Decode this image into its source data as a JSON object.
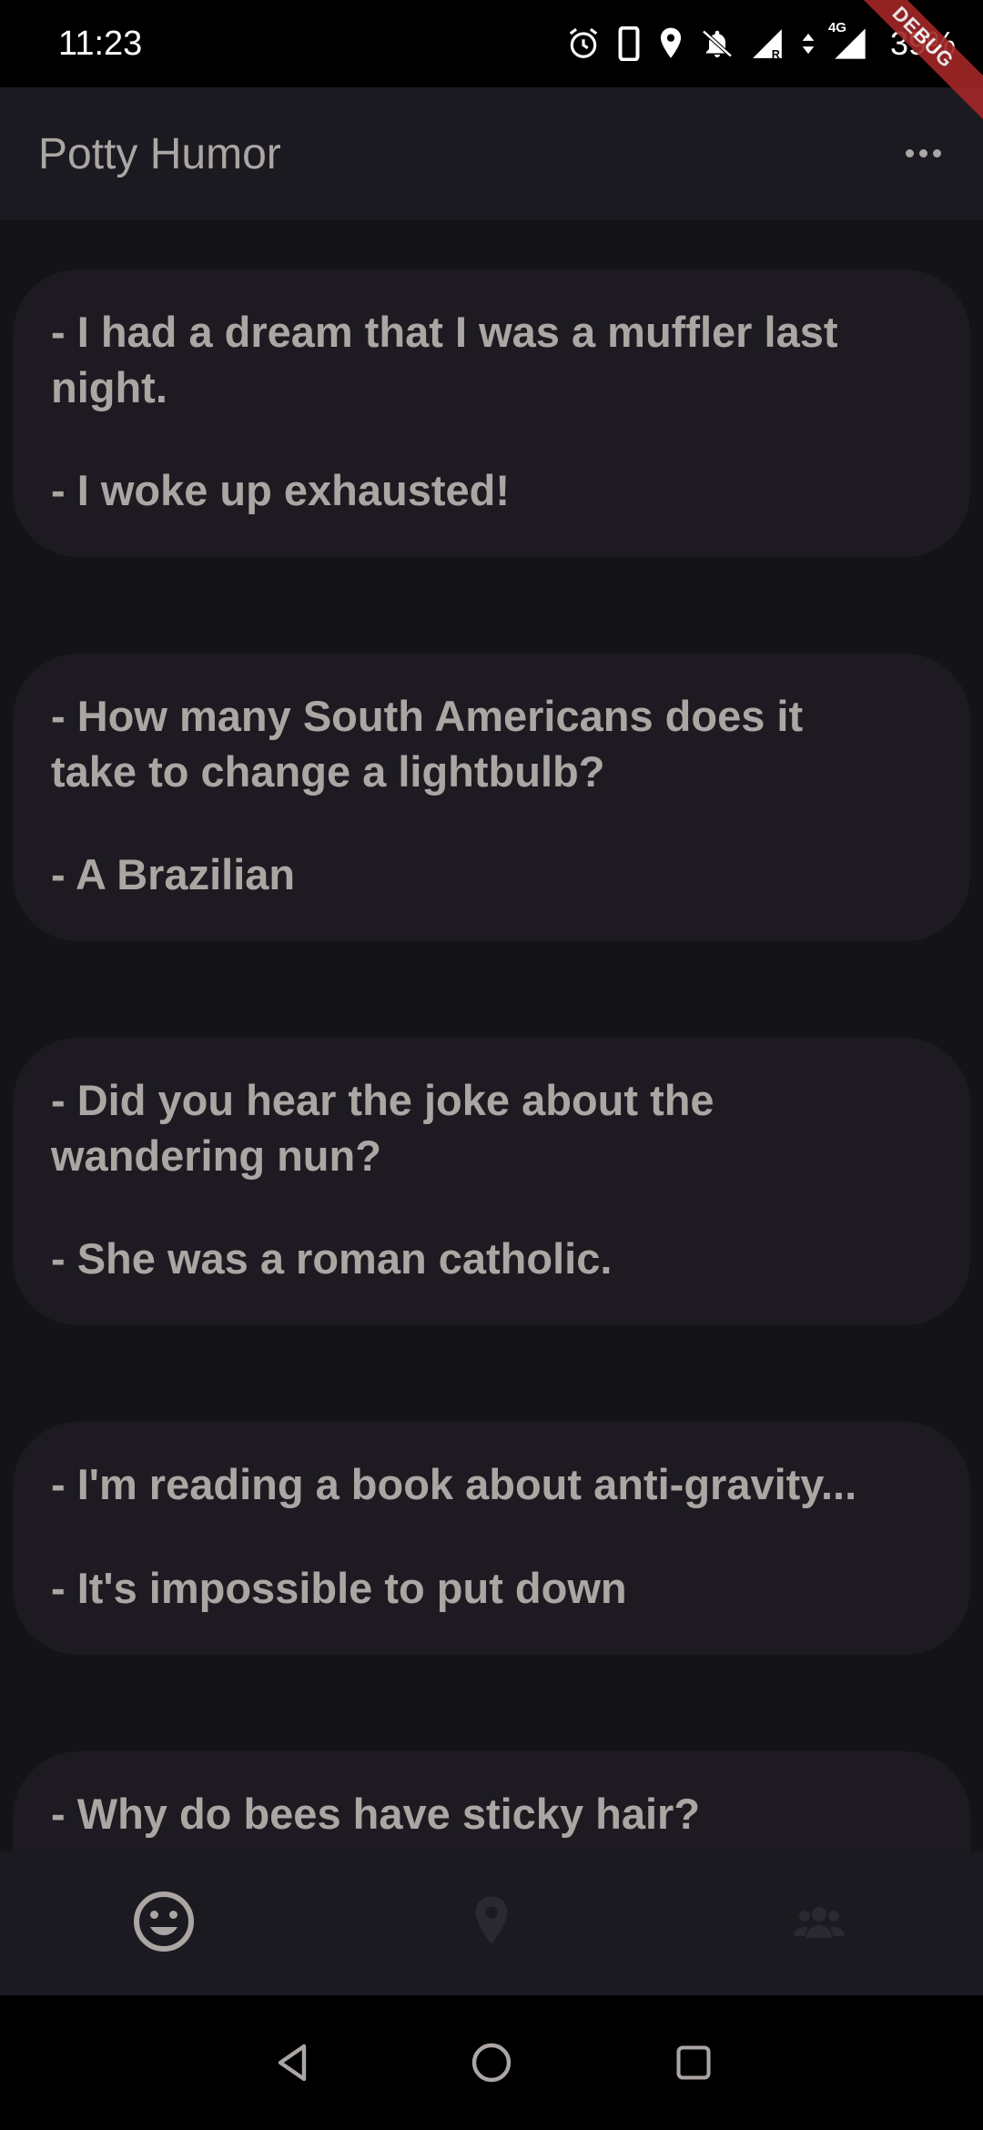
{
  "status_bar": {
    "time": "11:23",
    "battery_percent": "39%",
    "network_label": "4G",
    "icons": [
      "alarm-icon",
      "phone-icon",
      "location-icon",
      "notifications-off-icon",
      "signal-roaming-icon",
      "data-arrows-icon",
      "signal-icon"
    ]
  },
  "debug_banner": "DEBUG",
  "app_bar": {
    "title": "Potty Humor",
    "menu_icon": "more-horiz-icon"
  },
  "jokes": [
    {
      "setup_line1": "- I had a dream that I was a muffler last",
      "setup_line2": "night.",
      "punchline": "- I woke up exhausted!"
    },
    {
      "setup_line1": "- How many South Americans does it",
      "setup_line2": "take to change a lightbulb?",
      "punchline": "- A Brazilian"
    },
    {
      "setup_line1": "- Did you hear the joke about the",
      "setup_line2": "wandering nun?",
      "punchline": "- She was a roman catholic."
    },
    {
      "setup_line1": "- I'm reading a book about anti-gravity...",
      "punchline": "- It's impossible to put down"
    },
    {
      "setup_line1": "- Why do bees have sticky hair?"
    }
  ],
  "bottom_nav": {
    "items": [
      {
        "icon": "smiley-icon",
        "selected": true
      },
      {
        "icon": "location-pin-icon",
        "selected": false
      },
      {
        "icon": "group-icon",
        "selected": false
      }
    ]
  },
  "system_nav": {
    "items": [
      "back-icon",
      "home-icon",
      "recents-icon"
    ]
  },
  "colors": {
    "background": "#141318",
    "card": "#1d1b21",
    "bar": "#1b1a20",
    "text": "#aba6a3",
    "debug": "#a32727"
  }
}
